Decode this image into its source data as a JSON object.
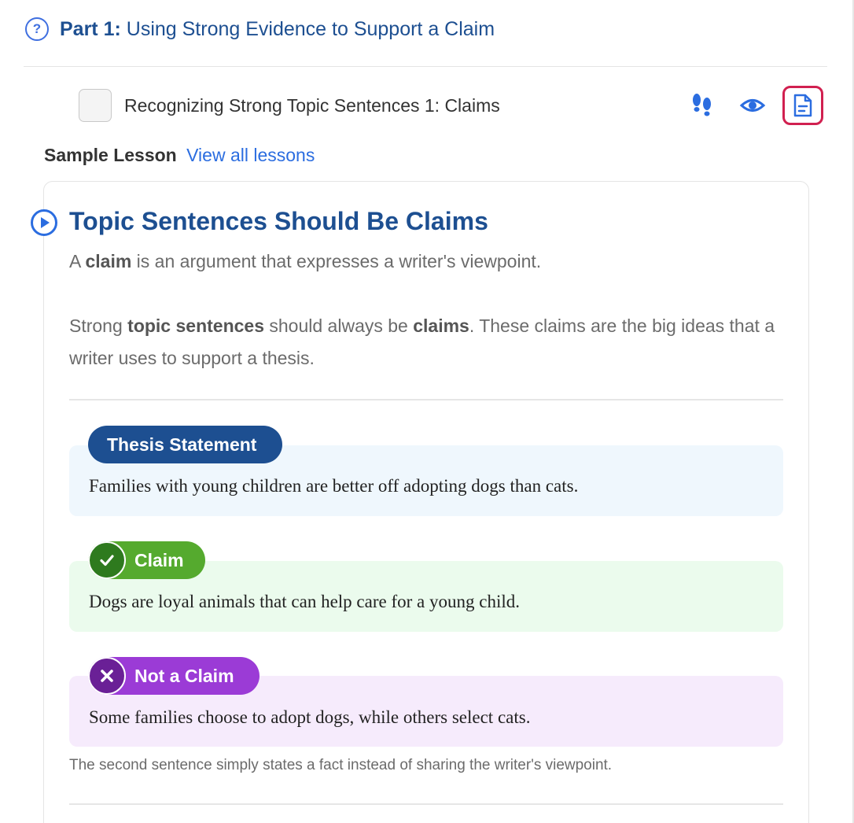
{
  "part": {
    "label": "Part 1:",
    "title": "Using Strong Evidence to Support a Claim",
    "help_icon": "question-circle-icon"
  },
  "activity": {
    "title": "Recognizing Strong Topic Sentences 1: Claims",
    "icons": [
      "footprints-icon",
      "eye-icon",
      "document-icon"
    ]
  },
  "sample": {
    "label": "Sample Lesson",
    "link": "View all lessons"
  },
  "lesson": {
    "title": "Topic Sentences Should Be Claims",
    "para1": {
      "a": "A ",
      "b": "claim",
      "c": " is an argument that expresses a writer's viewpoint."
    },
    "para2": {
      "a": "Strong ",
      "b": "topic sentences",
      "c": " should always be ",
      "d": "claims",
      "e": ". These claims are the big ideas that a writer uses to support a thesis."
    },
    "examples": {
      "thesis": {
        "label": "Thesis Statement",
        "text": "Families with young children are better off adopting dogs than cats."
      },
      "claim": {
        "label": "Claim",
        "text": "Dogs are loyal animals that can help care for a young child."
      },
      "not_claim": {
        "label": "Not a Claim",
        "text": "Some families choose to adopt dogs, while others select cats."
      }
    },
    "explanation": "The second sentence simply states a fact instead of sharing the writer's viewpoint."
  },
  "colors": {
    "primary_blue": "#1d4f91",
    "link_blue": "#2b6de0",
    "claim_green": "#55aa2e",
    "not_claim_purple": "#9b3bd6",
    "highlight_red": "#d12050"
  }
}
